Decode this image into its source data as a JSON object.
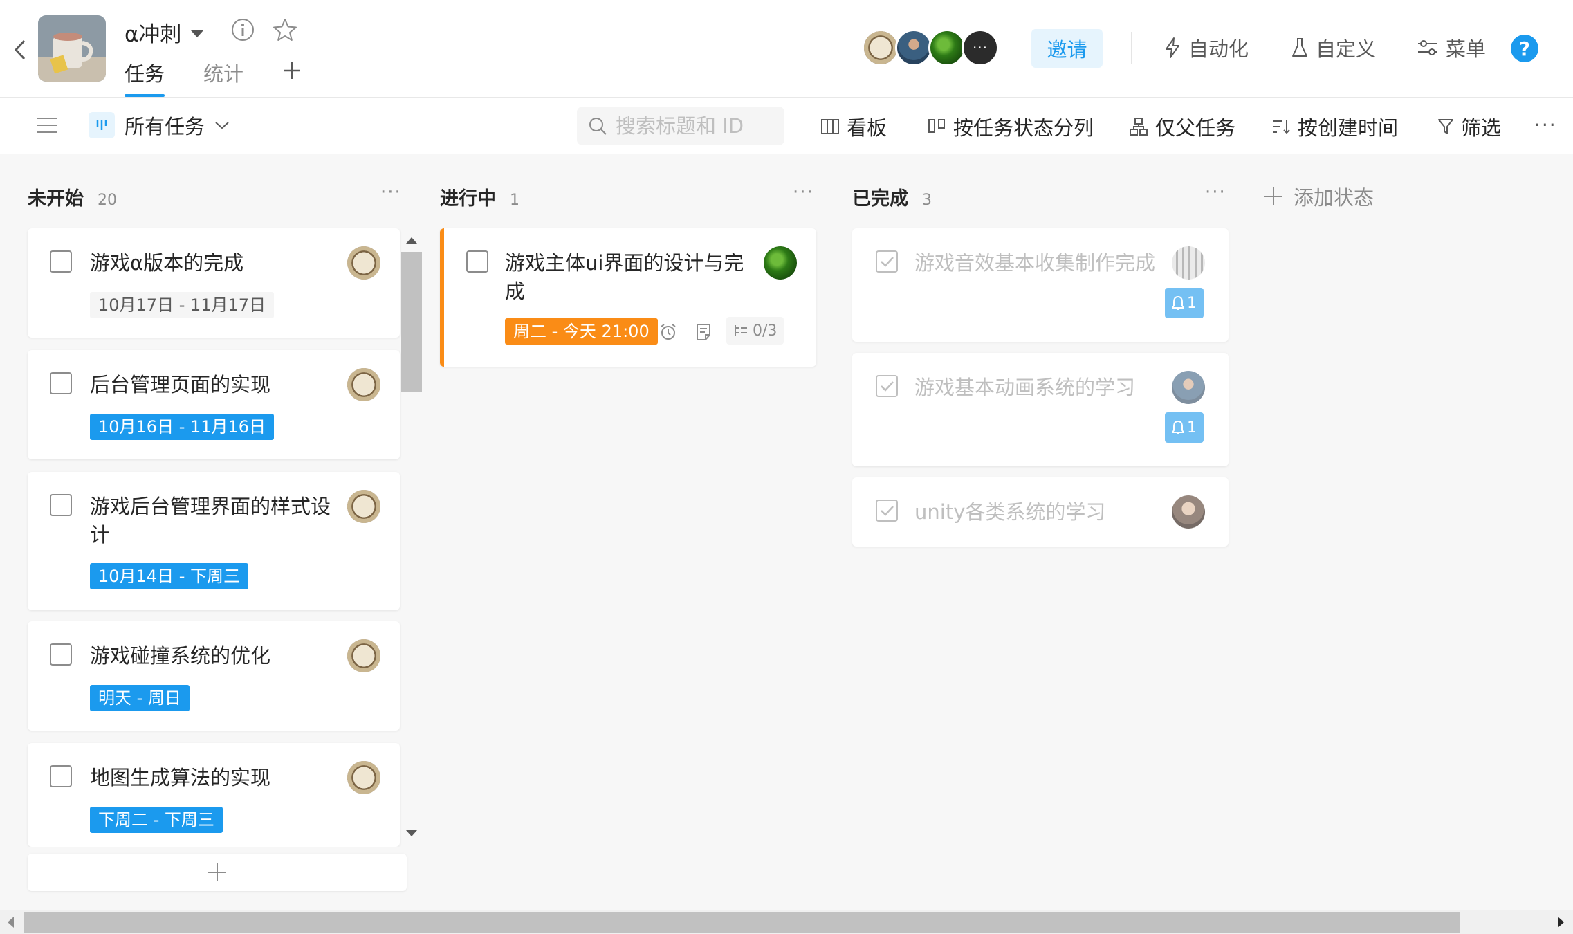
{
  "project": {
    "title": "α冲刺",
    "tabs": [
      {
        "label": "任务",
        "active": true
      },
      {
        "label": "统计",
        "active": false
      }
    ]
  },
  "header": {
    "invite_label": "邀请",
    "actions": [
      {
        "label": "自动化",
        "icon": "lightning-icon"
      },
      {
        "label": "自定义",
        "icon": "flask-icon"
      },
      {
        "label": "菜单",
        "icon": "sliders-icon"
      }
    ],
    "help_label": "?",
    "more_members_label": "···"
  },
  "toolbar": {
    "view_label": "所有任务",
    "search_placeholder": "搜索标题和 ID",
    "actions": [
      {
        "label": "看板",
        "icon": "board-icon"
      },
      {
        "label": "按任务状态分列",
        "icon": "columns-icon"
      },
      {
        "label": "仅父任务",
        "icon": "hierarchy-icon"
      },
      {
        "label": "按创建时间",
        "icon": "sort-icon"
      },
      {
        "label": "筛选",
        "icon": "filter-icon"
      }
    ],
    "more_label": "···"
  },
  "board": {
    "add_status_label": "添加状态",
    "columns": [
      {
        "title": "未开始",
        "count": "20",
        "cards": [
          {
            "title": "游戏α版本的完成",
            "date": "10月17日 - 11月17日",
            "date_style": "gray"
          },
          {
            "title": "后台管理页面的实现",
            "date": "10月16日 - 11月16日",
            "date_style": "blue"
          },
          {
            "title": "游戏后台管理界面的样式设计",
            "date": "10月14日 - 下周三",
            "date_style": "blue"
          },
          {
            "title": "游戏碰撞系统的优化",
            "date": "明天 - 周日",
            "date_style": "blue"
          },
          {
            "title": "地图生成算法的实现",
            "date": "下周二 - 下周三",
            "date_style": "blue"
          }
        ]
      },
      {
        "title": "进行中",
        "count": "1",
        "cards": [
          {
            "title": "游戏主体ui界面的设计与完成",
            "date": "周二 - 今天 21:00",
            "date_style": "orange",
            "subtasks": "0/3"
          }
        ]
      },
      {
        "title": "已完成",
        "count": "3",
        "cards": [
          {
            "title": "游戏音效基本收集制作完成",
            "reminders": "1"
          },
          {
            "title": "游戏基本动画系统的学习",
            "reminders": "1"
          },
          {
            "title": "unity各类系统的学习"
          }
        ]
      }
    ]
  },
  "colors": {
    "accent": "#1b9aee",
    "orange": "#fa8c16",
    "board_bg": "#f7f7f7"
  }
}
